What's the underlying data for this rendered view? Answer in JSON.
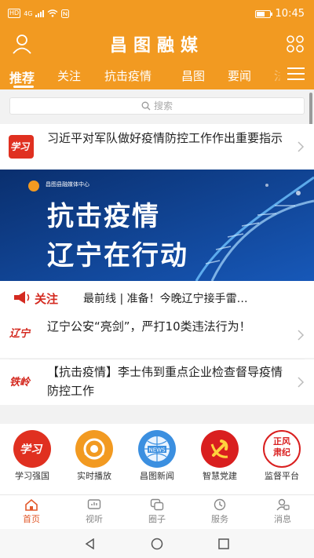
{
  "status_bar": {
    "time": "10:45",
    "signal_label": "HD",
    "network": "4G"
  },
  "header": {
    "title": "昌图融媒"
  },
  "tabs": [
    {
      "label": "推荐",
      "active": true
    },
    {
      "label": "关注"
    },
    {
      "label": "抗击疫情"
    },
    {
      "label": "昌图"
    },
    {
      "label": "要闻"
    },
    {
      "label": "法"
    }
  ],
  "search": {
    "placeholder": "搜索"
  },
  "news": [
    {
      "source_logo": "学习",
      "title": "习近平对军队做好疫情防控工作作出重要指示"
    }
  ],
  "banner": {
    "brand": "昌图县融媒体中心",
    "line1": "抗击疫情",
    "line2": "辽宁在行动"
  },
  "focus": {
    "label": "关注",
    "headline": "最前线 | 准备！今晚辽宁接手雷…"
  },
  "news_list": [
    {
      "logo": "辽宁",
      "title": "辽宁公安“亮剑”，严打10类违法行为！"
    },
    {
      "logo": "铁岭",
      "title": "【抗击疫情】李士伟到重点企业检查督导疫情防控工作"
    }
  ],
  "shortcuts": [
    {
      "label": "学习强国",
      "icon": "xuexi-icon",
      "color": "#e03020"
    },
    {
      "label": "实时播放",
      "icon": "live-icon",
      "color": "#f29a21"
    },
    {
      "label": "昌图新闻",
      "icon": "news-icon",
      "color": "#3b8fe0"
    },
    {
      "label": "智慧党建",
      "icon": "party-icon",
      "color": "#d91f1f"
    },
    {
      "label": "监督平台",
      "icon": "supervise-icon",
      "color": "#d91f1f"
    }
  ],
  "bottom_nav": [
    {
      "label": "首页",
      "active": true
    },
    {
      "label": "视听"
    },
    {
      "label": "圈子"
    },
    {
      "label": "服务"
    },
    {
      "label": "消息"
    }
  ],
  "colors": {
    "brand": "#f29a21",
    "accent": "#e2592b",
    "red": "#d42a20"
  }
}
